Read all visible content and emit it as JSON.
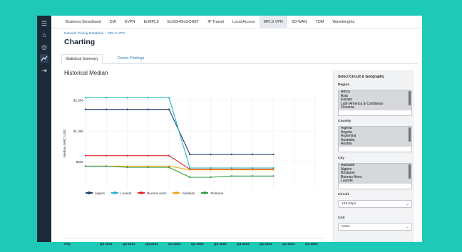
{
  "rail": {
    "icons": [
      "menu-icon",
      "home-icon",
      "compass-icon",
      "chart-icon",
      "logout-icon"
    ]
  },
  "topnav": {
    "items": [
      "Business Broadband",
      "DIA",
      "EVPN",
      "EoMPLS",
      "EoSDH/EoSONET",
      "IP Transit",
      "Local Access",
      "MPLS VPN",
      "SD-WAN",
      "TOM",
      "Wavelengths"
    ],
    "active": "MPLS VPN"
  },
  "breadcrumb": [
    "Network Pricing Database",
    "MPLS VPN"
  ],
  "page_title": "Charting",
  "tabs": [
    "Statistical Summary",
    "Carrier Postings"
  ],
  "chart_title": "Historical Median",
  "chart_data": {
    "type": "line",
    "title": "",
    "xlabel": "",
    "ylabel": "Median MRC USD",
    "categories": [
      "Q2 2021",
      "Q3 2021",
      "Q4 2021",
      "Q1 2022",
      "Q2 2022",
      "Q3 2022",
      "Q4 2022",
      "Q1 2023",
      "Q2 2023",
      "Q3 2023",
      "Q4 2023",
      "Q1 2024"
    ],
    "y_ticks": [
      "$500",
      "$1,000",
      "$1,500"
    ],
    "ylim": [
      100,
      1600
    ],
    "grid": true,
    "legend": "bottom",
    "series": [
      {
        "name": "Algiers",
        "color": "#1f3d6b",
        "values": [
          1350,
          1350,
          1350,
          1350,
          1350,
          620,
          620,
          620,
          620,
          620,
          null,
          null
        ]
      },
      {
        "name": "Luanda",
        "color": "#25b5c9",
        "values": [
          1540,
          1540,
          1540,
          1540,
          1540,
          400,
          400,
          400,
          400,
          400,
          null,
          null
        ]
      },
      {
        "name": "Buenos Aires",
        "color": "#e02a2a",
        "values": [
          600,
          600,
          600,
          600,
          600,
          380,
          380,
          380,
          380,
          380,
          null,
          null
        ]
      },
      {
        "name": "Adelaide",
        "color": "#f2a51c",
        "values": [
          430,
          430,
          430,
          430,
          430,
          370,
          370,
          370,
          370,
          370,
          null,
          null
        ]
      },
      {
        "name": "Brisbane",
        "color": "#2e9e44",
        "values": [
          430,
          430,
          410,
          410,
          410,
          250,
          250,
          270,
          270,
          270,
          null,
          null
        ]
      }
    ]
  },
  "table": {
    "headers": [
      "City",
      "Q2 2021",
      "Q3 2021",
      "Q4 2021",
      "Q1 2022",
      "Q2 2022",
      "Q3 2022",
      "Q4 2022",
      "Q1 2023",
      "Q2 2023",
      "Q3 2023"
    ]
  },
  "sidebar": {
    "heading": "Select Circuit & Geography",
    "region": {
      "label": "Region",
      "options": [
        "Africa",
        "Asia",
        "Europe",
        "Latin America & Caribbean",
        "Oceania"
      ]
    },
    "country": {
      "label": "Country",
      "options": [
        "Algeria",
        "Angola",
        "Argentina",
        "Australia",
        "Austria"
      ]
    },
    "city": {
      "label": "City",
      "options": [
        "Adelaide",
        "Algiers",
        "Brisbane",
        "Buenos Aires",
        "Luanda"
      ]
    },
    "circuit": {
      "label": "Circuit",
      "value": "128 Kbps"
    },
    "cos": {
      "label": "CoS",
      "value": "CoS1"
    }
  }
}
